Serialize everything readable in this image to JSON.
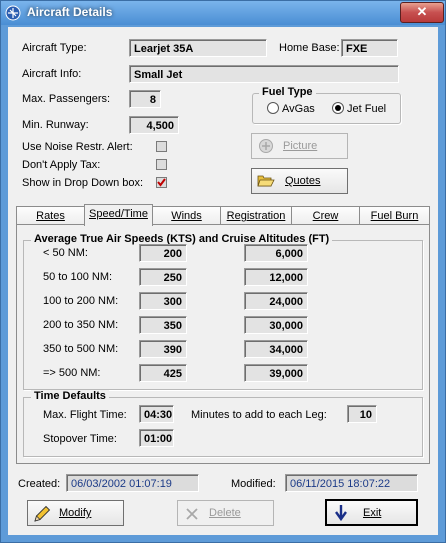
{
  "window": {
    "title": "Aircraft Details",
    "close_glyph": "✕"
  },
  "labels": {
    "aircraft_type": "Aircraft Type:",
    "home_base": "Home Base:",
    "aircraft_info": "Aircraft Info:",
    "max_passengers": "Max. Passengers:",
    "min_runway": "Min. Runway:",
    "noise_alert": "Use Noise Restr. Alert:",
    "dont_apply_tax": "Don't Apply Tax:",
    "show_dropdown": "Show in Drop Down box:"
  },
  "values": {
    "aircraft_type": "Learjet 35A",
    "home_base": "FXE",
    "aircraft_info": "Small Jet",
    "max_passengers": "8",
    "min_runway": "4,500"
  },
  "checkboxes": {
    "noise_alert": false,
    "dont_apply_tax": false,
    "show_dropdown": true
  },
  "fuel": {
    "title": "Fuel Type",
    "options": [
      "AvGas",
      "Jet Fuel"
    ],
    "selected": "Jet Fuel"
  },
  "buttons": {
    "picture": "Picture",
    "quotes": "Quotes",
    "modify": "Modify",
    "delete": "Delete",
    "exit": "Exit"
  },
  "tabs": [
    "Rates",
    "Speed/Time",
    "Winds",
    "Registration",
    "Crew",
    "Fuel Burn"
  ],
  "active_tab": "Speed/Time",
  "speed_group": {
    "title": "Average True Air Speeds (KTS) and Cruise Altitudes (FT)",
    "rows": [
      {
        "label": "< 50 NM:",
        "speed": "200",
        "altitude": "6,000"
      },
      {
        "label": "50 to 100 NM:",
        "speed": "250",
        "altitude": "12,000"
      },
      {
        "label": "100 to 200 NM:",
        "speed": "300",
        "altitude": "24,000"
      },
      {
        "label": "200 to 350 NM:",
        "speed": "350",
        "altitude": "30,000"
      },
      {
        "label": "350 to 500 NM:",
        "speed": "390",
        "altitude": "34,000"
      },
      {
        "label": "=> 500  NM:",
        "speed": "425",
        "altitude": "39,000"
      }
    ]
  },
  "time_defaults": {
    "title": "Time Defaults",
    "max_flight_label": "Max. Flight Time:",
    "max_flight_value": "04:30",
    "minutes_label": "Minutes to add to each Leg:",
    "minutes_value": "10",
    "stopover_label": "Stopover Time:",
    "stopover_value": "01:00"
  },
  "footer": {
    "created_label": "Created:",
    "created_value": "06/03/2002 01:07:19",
    "modified_label": "Modified:",
    "modified_value": "06/11/2015 18:07:22"
  },
  "colors": {
    "title_bar": "#4a8ed4",
    "close": "#c75050",
    "check_mark": "#c00000",
    "field_text_blue": "#1c3b88"
  }
}
